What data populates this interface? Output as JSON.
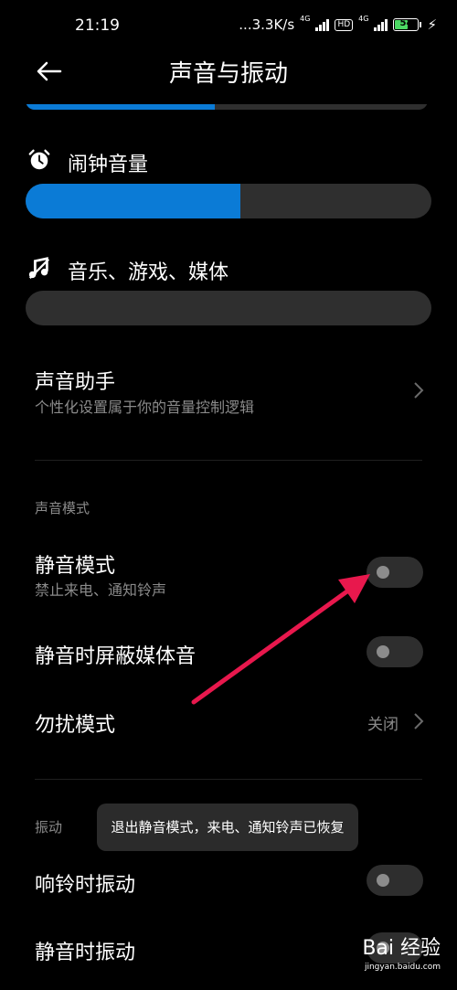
{
  "status": {
    "time": "21:19",
    "net_speed": "...3.3K/s",
    "signal_1_tag": "4G",
    "hd_badge": "HD",
    "signal_2_tag": "4G",
    "battery": "54",
    "battery_level_percent": 54
  },
  "header": {
    "title": "声音与振动"
  },
  "volumes": {
    "top_level_percent": 47,
    "alarm": {
      "label": "闹钟音量",
      "level_percent": 53
    },
    "media": {
      "label": "音乐、游戏、媒体",
      "level_percent": 0
    }
  },
  "assistant": {
    "title": "声音助手",
    "subtitle": "个性化设置属于你的音量控制逻辑"
  },
  "sound_mode": {
    "section": "声音模式",
    "silent": {
      "title": "静音模式",
      "subtitle": "禁止来电、通知铃声",
      "enabled": false
    },
    "mute_media": {
      "title": "静音时屏蔽媒体音",
      "enabled": false
    },
    "dnd": {
      "title": "勿扰模式",
      "value": "关闭"
    }
  },
  "vibration": {
    "section": "振动",
    "ring_vibrate": {
      "title": "响铃时振动",
      "enabled": false
    },
    "silent_vibrate": {
      "title": "静音时振动",
      "enabled": false
    }
  },
  "toast": "退出静音模式，来电、通知铃声已恢复",
  "watermark": {
    "brand": "Bai 经验",
    "url": "jingyan.baidu.com"
  },
  "colors": {
    "accent": "#0b7bd6",
    "annotation_arrow": "#e8184d"
  }
}
